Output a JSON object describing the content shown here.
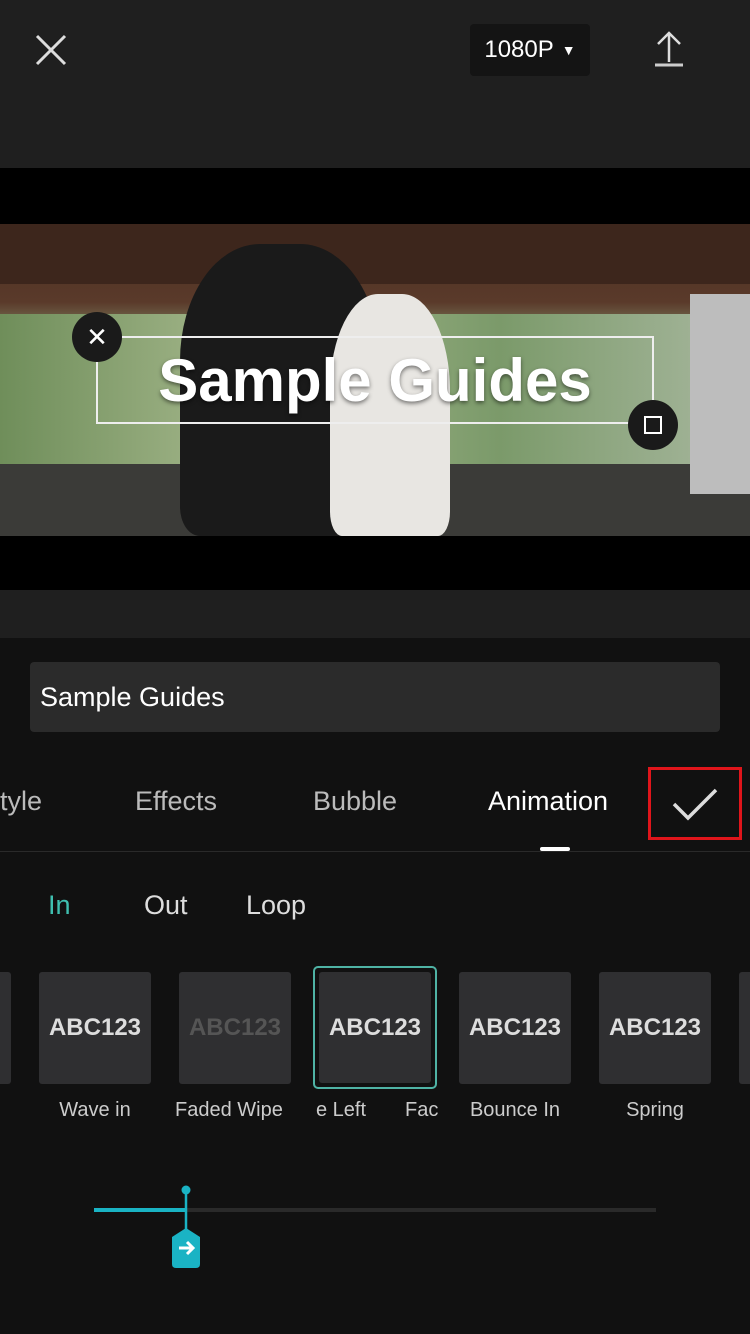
{
  "topbar": {
    "resolution": "1080P"
  },
  "preview": {
    "overlay_text": "Sample Guides"
  },
  "editor": {
    "text_value": "Sample Guides"
  },
  "tabs": [
    {
      "label": "tyle"
    },
    {
      "label": "Effects"
    },
    {
      "label": "Bubble"
    },
    {
      "label": "Animation",
      "active": true
    }
  ],
  "subtabs": [
    {
      "label": "In",
      "active": true
    },
    {
      "label": "Out"
    },
    {
      "label": "Loop"
    }
  ],
  "animations": [
    {
      "preview": "ABC123",
      "label": "Wave in"
    },
    {
      "preview": "ABC123",
      "label": "Faded Wipe"
    },
    {
      "preview": "ABC123",
      "label": "e Left",
      "selected": true
    },
    {
      "preview": "ABC123",
      "label": "Bounce In"
    },
    {
      "preview": "ABC123",
      "label": "Spring"
    }
  ],
  "partial_label": "Fac",
  "duration_slider": {
    "value_fraction": 0.164
  },
  "colors": {
    "accent": "#1ab3c4",
    "selected_border": "#4fb3a5",
    "highlight_box": "#e0151b"
  }
}
